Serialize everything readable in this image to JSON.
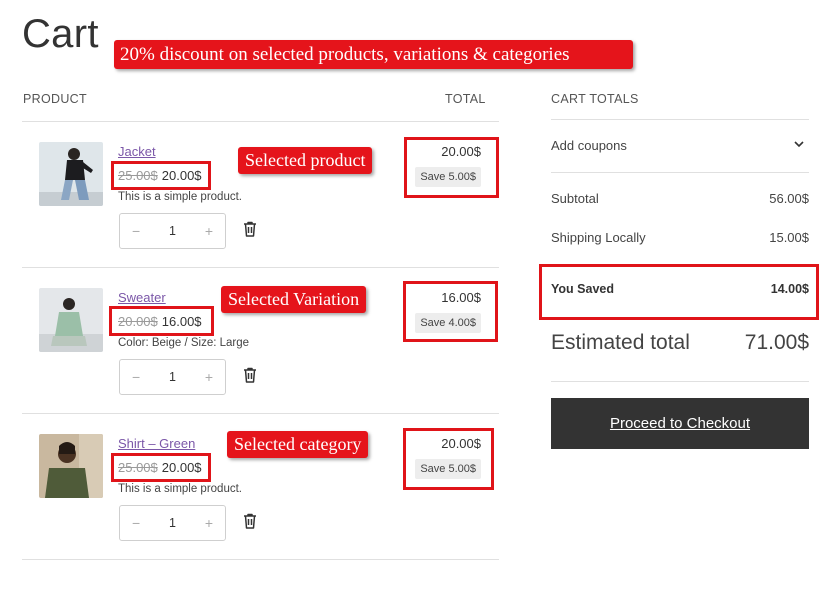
{
  "page": {
    "title": "Cart",
    "promo_banner": "20% discount on selected products, variations & categories"
  },
  "table": {
    "product_header": "PRODUCT",
    "total_header": "TOTAL"
  },
  "items": [
    {
      "name": "Jacket",
      "old_price": "25.00$",
      "new_price": "20.00$",
      "description": "This is a simple product.",
      "quantity": "1",
      "total": "20.00$",
      "save": "Save 5.00$",
      "callout": "Selected product",
      "image": "jacket-model-photo"
    },
    {
      "name": "Sweater",
      "old_price": "20.00$",
      "new_price": "16.00$",
      "description": "Color: Beige / Size: Large",
      "quantity": "1",
      "total": "16.00$",
      "save": "Save 4.00$",
      "callout": "Selected Variation",
      "image": "sweater-model-photo"
    },
    {
      "name": "Shirt – Green",
      "old_price": "25.00$",
      "new_price": "20.00$",
      "description": "This is a simple product.",
      "quantity": "1",
      "total": "20.00$",
      "save": "Save 5.00$",
      "callout": "Selected category",
      "image": "shirt-model-photo"
    }
  ],
  "quantity_controls": {
    "minus": "−",
    "plus": "+"
  },
  "icons": {
    "remove": "trash-icon",
    "coupon_toggle": "chevron-down-icon"
  },
  "totals": {
    "title": "CART TOTALS",
    "coupons_label": "Add coupons",
    "subtotal_label": "Subtotal",
    "subtotal_value": "56.00$",
    "shipping_label": "Shipping Locally",
    "shipping_value": "15.00$",
    "saved_label": "You Saved",
    "saved_value": "14.00$",
    "estimated_label": "Estimated total",
    "estimated_value": "71.00$",
    "checkout_label": "Proceed to Checkout"
  },
  "colors": {
    "annotation_red": "#e5141b",
    "link_purple": "#7b57a8",
    "checkout_bg": "#333333",
    "badge_bg": "#ededed"
  }
}
